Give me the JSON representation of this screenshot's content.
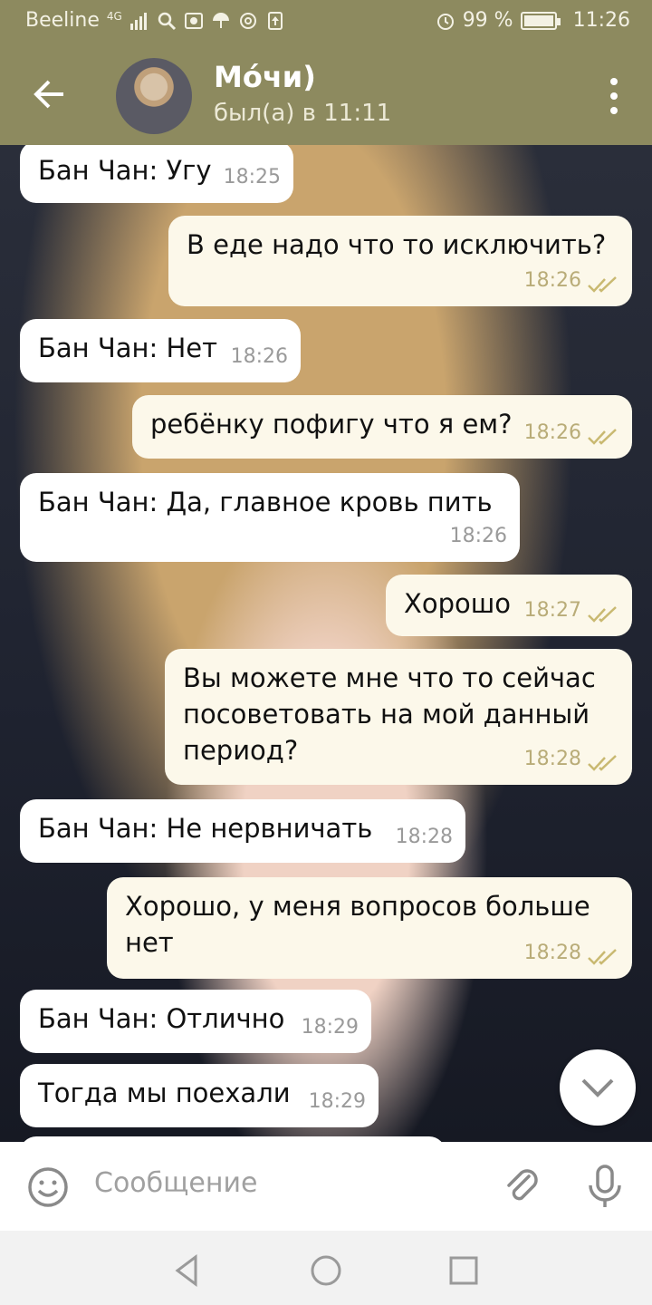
{
  "status_bar": {
    "carrier": "Beeline",
    "network": "4G",
    "battery": "99 %",
    "battery_level": 0.99,
    "time": "11:26"
  },
  "header": {
    "title": "Мо́чи)",
    "subtitle": "был(а) в 11:11",
    "back_icon": "arrow-left-icon",
    "menu_icon": "more-vertical-icon"
  },
  "messages": [
    {
      "dir": "in",
      "text": "Бан Чан: Угу",
      "time": "18:25"
    },
    {
      "dir": "out",
      "text": "В еде надо что то исключить?",
      "time": "18:26"
    },
    {
      "dir": "in",
      "text": "Бан Чан: Нет",
      "time": "18:26"
    },
    {
      "dir": "out",
      "text": "ребёнку пофигу что я ем?",
      "time": "18:26"
    },
    {
      "dir": "in",
      "text": "Бан Чан: Да, главное кровь пить",
      "time": "18:26"
    },
    {
      "dir": "out",
      "text": "Хорошо",
      "time": "18:27"
    },
    {
      "dir": "out",
      "text": "Вы можете мне что то сейчас посоветовать на мой данный период?",
      "time": "18:28"
    },
    {
      "dir": "in",
      "text": "Бан Чан: Не нервничать",
      "time": "18:28"
    },
    {
      "dir": "out",
      "text": "Хорошо, у меня вопросов больше нет",
      "time": "18:28"
    },
    {
      "dir": "in",
      "text": "Бан Чан: Отлично",
      "time": "18:29"
    },
    {
      "dir": "in",
      "text": "Тогда мы поехали",
      "time": "18:29"
    }
  ],
  "input": {
    "placeholder": "Сообщение"
  },
  "colors": {
    "header": "#8d8a5f",
    "incoming": "#ffffff",
    "outgoing": "#fcf8ea",
    "ticks": "#c9b971"
  }
}
